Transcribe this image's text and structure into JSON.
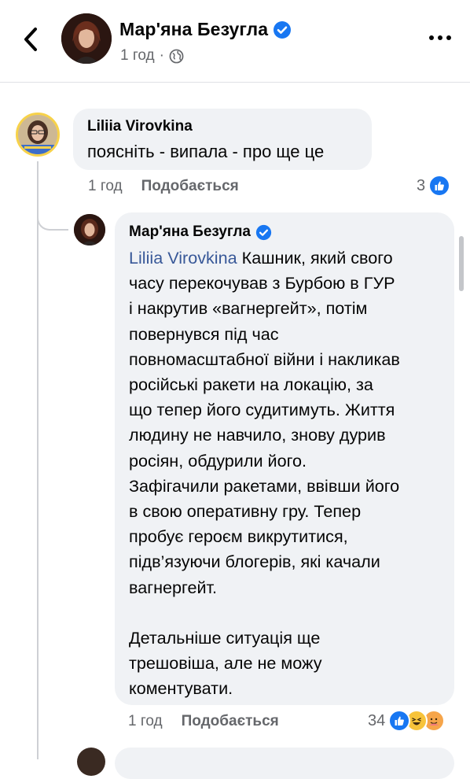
{
  "header": {
    "author_name": "Мар'яна Безугла",
    "time": "1 год",
    "separator": "·",
    "icons": {
      "back": "chevron-left-icon",
      "verified": "verified-badge-icon",
      "privacy": "globe-icon",
      "more": "more-dots-icon"
    }
  },
  "comments": [
    {
      "author": "Liliia Virovkina",
      "text": "поясніть - випала - про ще це",
      "time": "1 год",
      "like_label": "Подобається",
      "reaction_count": "3",
      "reactions": [
        "like"
      ]
    },
    {
      "author": "Мар'яна Безугла",
      "verified": true,
      "mention": "Liliia Virovkina",
      "text": " Кашник, який свого\nчасу перекочував з Бурбою в ГУР\nі накрутив «вагнергейт», потім\nповернувся під час\nповномасштабної війни і накликав\nросійські ракети на локацію, за\nщо тепер його судитимуть. Життя\nлюдину не навчило, знову дурив\nросіян, обдурили його.\nЗафігачили ракетами, ввівши його\nв свою оперативну гру. Тепер\nпробує героєм викрутитися,\nпідв’язуючи блогерів, які качали\nвагнергейт.\n\nДетальніше ситуація ще\nтрешовіша, але не можу\nкоментувати.",
      "time": "1 год",
      "like_label": "Подобається",
      "reaction_count": "34",
      "reactions": [
        "like",
        "haha",
        "care"
      ]
    }
  ],
  "colors": {
    "link": "#385898",
    "like_blue": "#1877f2",
    "bubble": "#f0f2f5",
    "secondary_text": "#65676b",
    "verified": "#1877f2"
  }
}
